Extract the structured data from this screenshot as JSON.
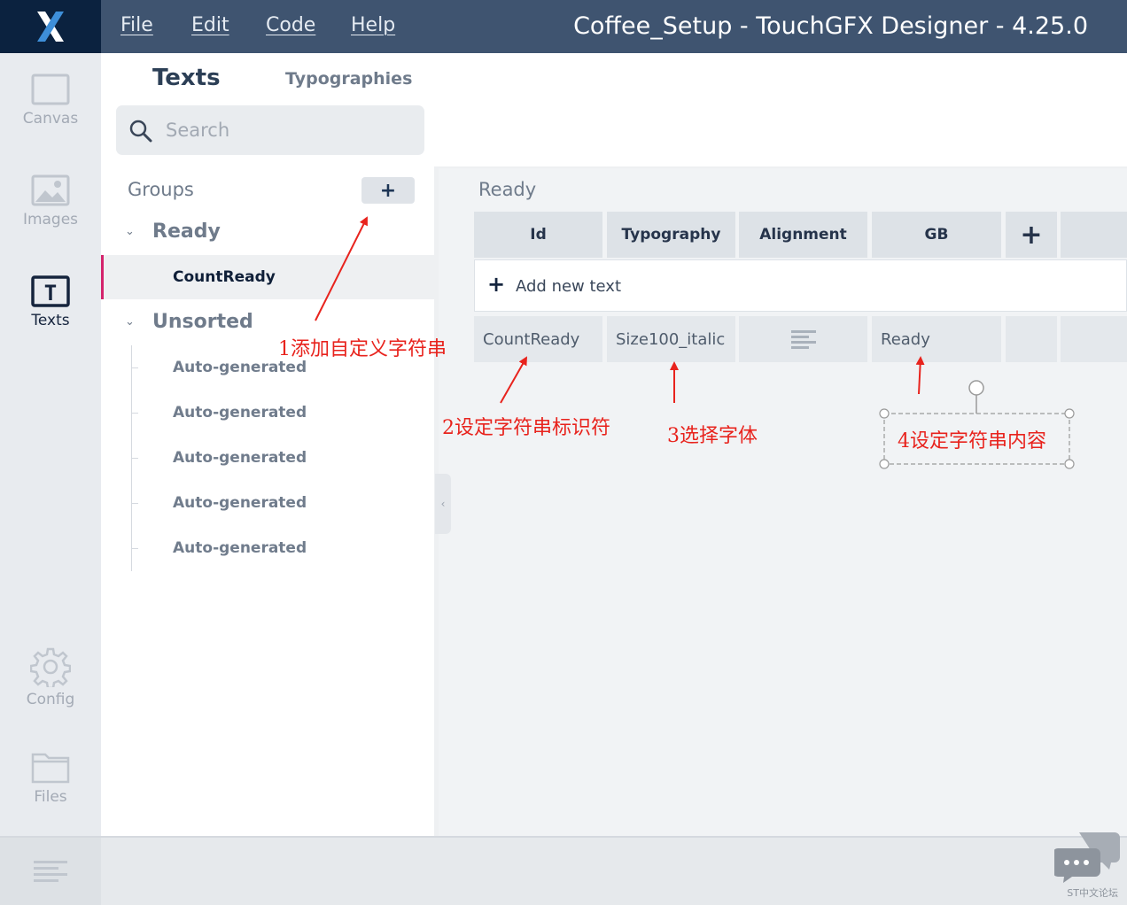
{
  "window": {
    "title": "Coffee_Setup - TouchGFX Designer - 4.25.0"
  },
  "menu": [
    {
      "label": "File"
    },
    {
      "label": "Edit"
    },
    {
      "label": "Code"
    },
    {
      "label": "Help"
    }
  ],
  "nav": {
    "canvas": "Canvas",
    "images": "Images",
    "texts": "Texts",
    "config": "Config",
    "files": "Files"
  },
  "tabs": {
    "texts": "Texts",
    "typographies": "Typographies"
  },
  "search": {
    "placeholder": "Search",
    "value": ""
  },
  "groups": {
    "label": "Groups",
    "add_symbol": "+",
    "ready": {
      "name": "Ready",
      "items": [
        "CountReady"
      ]
    },
    "unsorted": {
      "name": "Unsorted",
      "items": [
        "Auto-generated",
        "Auto-generated",
        "Auto-generated",
        "Auto-generated",
        "Auto-generated"
      ]
    }
  },
  "table": {
    "group_title": "Ready",
    "headers": {
      "id": "Id",
      "typography": "Typography",
      "alignment": "Alignment",
      "gb": "GB",
      "add_symbol": "+"
    },
    "add_new_text": {
      "symbol": "+",
      "label": "Add new text"
    },
    "rows": [
      {
        "id": "CountReady",
        "typography": "Size100_italic",
        "alignment": "left",
        "gb": "Ready"
      }
    ]
  },
  "annotations": {
    "a1": "1添加自定义字符串",
    "a2": "2设定字符串标识符",
    "a3": "3选择字体",
    "a4": "4设定字符串内容",
    "color": "#e8231d"
  },
  "watermark": {
    "label": "ST中文论坛"
  },
  "colors": {
    "titlebar": "#3f5470",
    "logo_bg": "#0b223f",
    "selection_accent": "#d4246c",
    "annotation": "#e8231d"
  }
}
